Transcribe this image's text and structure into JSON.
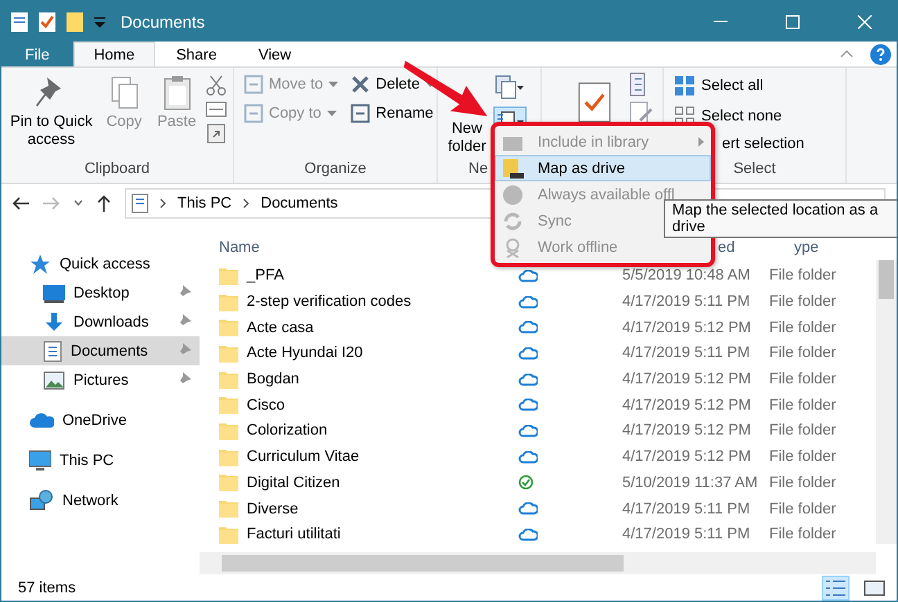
{
  "window": {
    "title": "Documents"
  },
  "tabs": [
    {
      "label": "File",
      "kind": "file",
      "selected": false
    },
    {
      "label": "Home",
      "kind": "tab",
      "selected": true
    },
    {
      "label": "Share",
      "kind": "tab",
      "selected": false
    },
    {
      "label": "View",
      "kind": "tab",
      "selected": false
    }
  ],
  "ribbon": {
    "groups": [
      {
        "label": "Clipboard",
        "buttons": [
          {
            "label": "Pin to Quick access",
            "disabled": false
          },
          {
            "label": "Copy",
            "disabled": true
          },
          {
            "label": "Paste",
            "disabled": true
          }
        ]
      },
      {
        "label": "Organize",
        "buttons": [
          {
            "label": "Move to",
            "disabled": true
          },
          {
            "label": "Copy to",
            "disabled": true
          },
          {
            "label": "Delete",
            "disabled": false
          },
          {
            "label": "Rename",
            "disabled": false
          }
        ]
      },
      {
        "label": "Ne",
        "buttons": [
          {
            "label": "New folder",
            "disabled": false
          }
        ]
      },
      {
        "label": "Select",
        "buttons": [
          {
            "label": "Select all",
            "disabled": false
          },
          {
            "label": "Select none",
            "disabled": false
          },
          {
            "label": "ert selection",
            "disabled": false
          }
        ]
      }
    ]
  },
  "address": {
    "path": [
      "This PC",
      "Documents"
    ]
  },
  "nav": {
    "items": [
      {
        "label": "Quick access",
        "pinned": false,
        "selected": false
      },
      {
        "label": "Desktop",
        "pinned": true,
        "selected": false
      },
      {
        "label": "Downloads",
        "pinned": true,
        "selected": false
      },
      {
        "label": "Documents",
        "pinned": true,
        "selected": true
      },
      {
        "label": "Pictures",
        "pinned": true,
        "selected": false
      },
      {
        "label": "OneDrive",
        "pinned": false,
        "selected": false
      },
      {
        "label": "This PC",
        "pinned": false,
        "selected": false
      },
      {
        "label": "Network",
        "pinned": false,
        "selected": false
      }
    ]
  },
  "table": {
    "columns": [
      "Name",
      "ed",
      "ype"
    ],
    "rows": [
      {
        "name": "_PFA",
        "kind": "online",
        "date": "5/5/2019 10:48 AM",
        "type": "File folder"
      },
      {
        "name": "2-step verification codes",
        "kind": "online",
        "date": "4/17/2019 5:11 PM",
        "type": "File folder"
      },
      {
        "name": "Acte casa",
        "kind": "online",
        "date": "4/17/2019 5:12 PM",
        "type": "File folder"
      },
      {
        "name": "Acte Hyundai I20",
        "kind": "online",
        "date": "4/17/2019 5:11 PM",
        "type": "File folder"
      },
      {
        "name": "Bogdan",
        "kind": "online",
        "date": "4/17/2019 5:12 PM",
        "type": "File folder"
      },
      {
        "name": "Cisco",
        "kind": "online",
        "date": "4/17/2019 5:12 PM",
        "type": "File folder"
      },
      {
        "name": "Colorization",
        "kind": "online",
        "date": "4/17/2019 5:12 PM",
        "type": "File folder"
      },
      {
        "name": "Curriculum Vitae",
        "kind": "online",
        "date": "4/17/2019 5:12 PM",
        "type": "File folder"
      },
      {
        "name": "Digital Citizen",
        "kind": "synced",
        "date": "5/10/2019 11:37 AM",
        "type": "File folder"
      },
      {
        "name": "Diverse",
        "kind": "online",
        "date": "4/17/2019 5:11 PM",
        "type": "File folder"
      },
      {
        "name": "Facturi utilitati",
        "kind": "online",
        "date": "4/17/2019 5:11 PM",
        "type": "File folder"
      }
    ]
  },
  "menu": {
    "items": [
      {
        "label": "Include in library",
        "disabled": true,
        "submenu": true,
        "selected": false
      },
      {
        "label": "Map as drive",
        "disabled": false,
        "submenu": false,
        "selected": true
      },
      {
        "label": "Always available offl",
        "disabled": true,
        "submenu": false,
        "selected": false
      },
      {
        "label": "Sync",
        "disabled": true,
        "submenu": false,
        "selected": false
      },
      {
        "label": "Work offline",
        "disabled": true,
        "submenu": false,
        "selected": false
      }
    ]
  },
  "tooltip": {
    "text": "Map the selected location as a drive"
  },
  "status_bar": {
    "text": "57 items"
  }
}
